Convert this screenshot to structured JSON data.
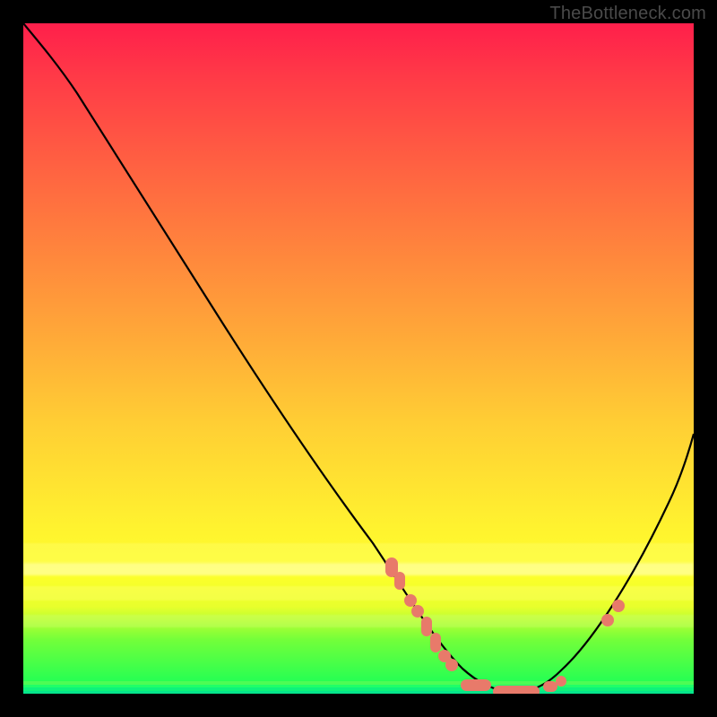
{
  "watermark": "TheBottleneck.com",
  "chart_data": {
    "type": "line",
    "title": "",
    "xlabel": "",
    "ylabel": "",
    "xlim": [
      0,
      100
    ],
    "ylim": [
      0,
      100
    ],
    "grid": false,
    "series": [
      {
        "name": "curve",
        "x": [
          0,
          4,
          8,
          12,
          18,
          26,
          34,
          42,
          50,
          55,
          58,
          60,
          62,
          65,
          68,
          72,
          76,
          80,
          85,
          90,
          95,
          100
        ],
        "values": [
          100,
          97,
          93,
          89,
          82,
          72,
          60,
          47,
          33,
          23,
          16,
          11,
          7,
          3,
          1,
          0,
          1,
          4,
          10,
          20,
          32,
          47
        ]
      }
    ],
    "markers": {
      "description": "Emphasized points/pills along the curve near the trough and on the right slope",
      "cluster_left_descent_x": [
        55,
        56,
        57,
        58,
        59,
        60,
        61,
        62
      ],
      "trough_pills_x": [
        64,
        66,
        68,
        70,
        72,
        74,
        76,
        78
      ],
      "right_ascent_dots_x": [
        86,
        88
      ]
    },
    "background": {
      "type": "vertical_gradient",
      "stops": [
        {
          "pos": 0,
          "color": "#ff1f4b"
        },
        {
          "pos": 18,
          "color": "#ff5843"
        },
        {
          "pos": 45,
          "color": "#ffa439"
        },
        {
          "pos": 75,
          "color": "#fff22f"
        },
        {
          "pos": 92,
          "color": "#72ff3a"
        },
        {
          "pos": 100,
          "color": "#10ff5a"
        }
      ],
      "bottom_green_stripes": true
    }
  }
}
